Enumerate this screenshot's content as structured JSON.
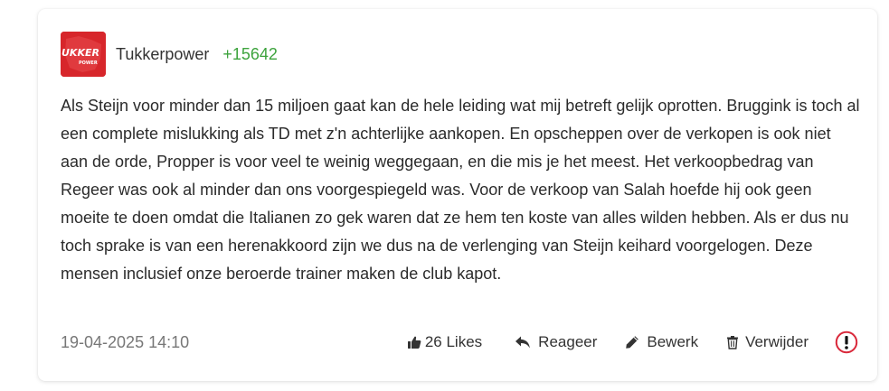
{
  "post": {
    "author": "Tukkerpower",
    "karma": "+15642",
    "avatar_text": "UKKER",
    "avatar_subtext": "POWER",
    "body": "Als Steijn voor minder dan 15 miljoen gaat kan de hele leiding wat mij betreft gelijk oprotten. Bruggink is toch al een complete mislukking als TD met z'n achterlijke aankopen. En opscheppen over de verkopen is ook niet aan de orde, Propper is voor veel te weinig weggegaan, en die mis je het meest. Het verkoopbedrag van Regeer was ook al minder dan ons voorgespiegeld was. Voor de verkoop van Salah hoefde hij ook geen moeite te doen omdat die Italianen zo gek waren dat ze hem ten koste van alles wilden hebben. Als er dus nu toch sprake is van een herenakkoord zijn we dus na de verlenging van Steijn keihard voorgelogen. Deze mensen inclusief onze beroerde trainer maken de club kapot.",
    "timestamp": "19-04-2025 14:10"
  },
  "actions": {
    "likes_label": "26 Likes",
    "reply_label": "Reageer",
    "edit_label": "Bewerk",
    "delete_label": "Verwijder"
  },
  "icons": {
    "likes": "thumbs-up-icon",
    "reply": "reply-arrow-icon",
    "edit": "pencil-icon",
    "delete": "trash-icon",
    "report": "exclamation-circle-icon"
  },
  "colors": {
    "karma": "#3da33d",
    "avatar_bg": "#d7262b",
    "report": "#d9283a",
    "timestamp": "#777777"
  }
}
